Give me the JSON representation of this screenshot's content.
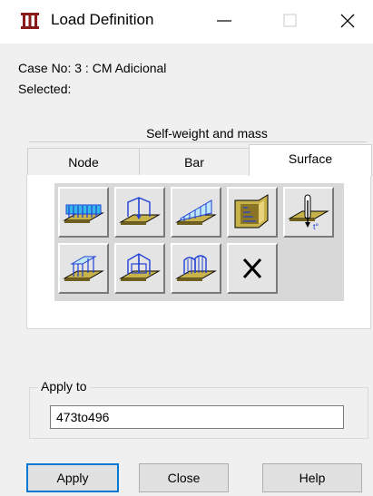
{
  "window": {
    "title": "Load Definition",
    "app_icon": "load-definition-icon"
  },
  "info": {
    "case": "Case No: 3 : CM Adicional",
    "selected": "Selected:"
  },
  "group_label": "Self-weight and mass",
  "tabs": [
    {
      "label": "Node",
      "active": false
    },
    {
      "label": "Bar",
      "active": false
    },
    {
      "label": "Surface",
      "active": true
    }
  ],
  "tools": [
    {
      "icon": "uniform-surface-load-icon"
    },
    {
      "icon": "point-load-on-surface-icon"
    },
    {
      "icon": "linear-load-on-edges-icon"
    },
    {
      "icon": "hydrostatic-pressure-icon"
    },
    {
      "icon": "thermal-load-icon"
    },
    {
      "icon": "planar-load-on-contour-icon"
    },
    {
      "icon": "point-load-on-contour-icon"
    },
    {
      "icon": "linear-load-on-contour-icon"
    },
    {
      "icon": "delete-load-icon"
    }
  ],
  "apply_to": {
    "label": "Apply to",
    "value": "473to496"
  },
  "buttons": {
    "apply": "Apply",
    "close": "Close",
    "help": "Help"
  },
  "colors": {
    "accent": "#0078d7",
    "surface_fill": "#c8b24a",
    "load_blue": "#1f3fd6",
    "load_cyan": "#35b8e8"
  }
}
